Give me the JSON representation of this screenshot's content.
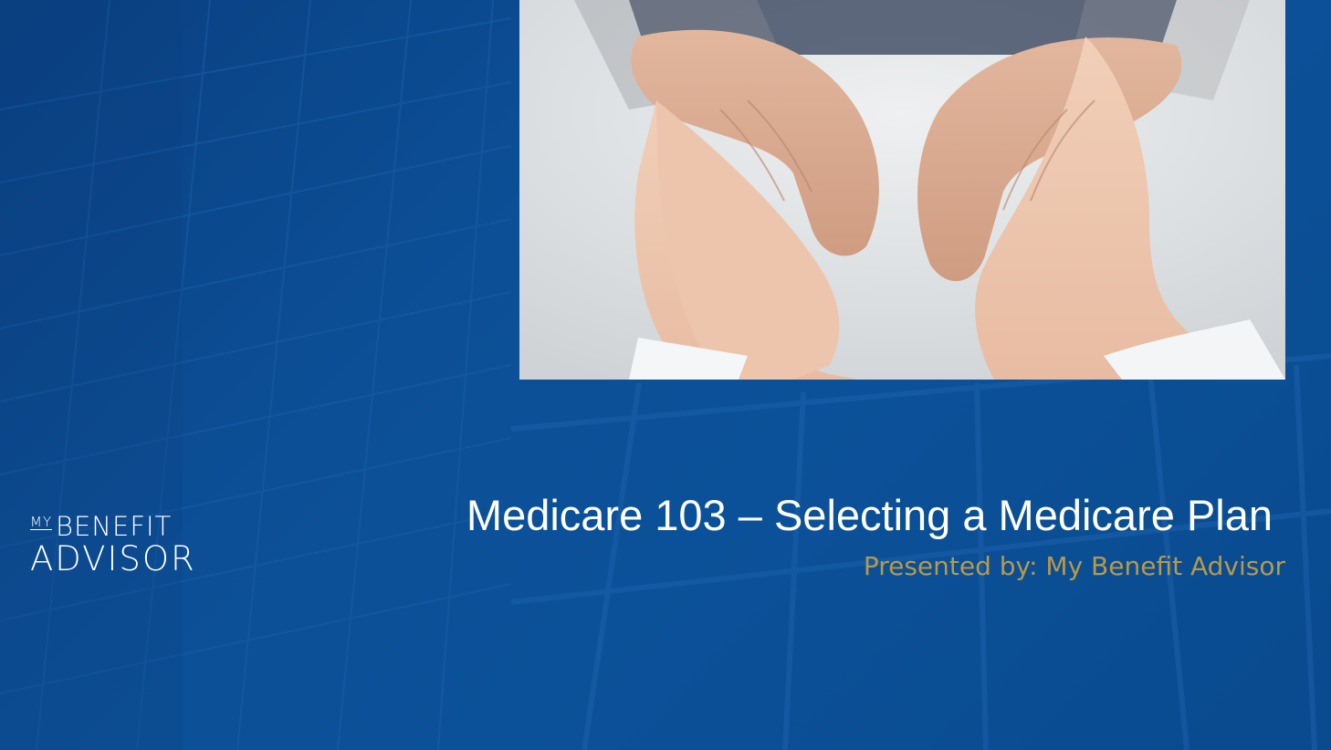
{
  "slide": {
    "title": "Medicare 103 – Selecting a Medicare Plan",
    "subtitle": "Presented by: My Benefit Advisor"
  },
  "logo": {
    "my": "MY",
    "benefit": "BENEFIT",
    "advisor": "ADVISOR"
  },
  "photo": {
    "subject": "hands-holding-hands-icon"
  },
  "colors": {
    "background": "#0b4f97",
    "title": "#ffffff",
    "subtitle": "#b8994a"
  }
}
